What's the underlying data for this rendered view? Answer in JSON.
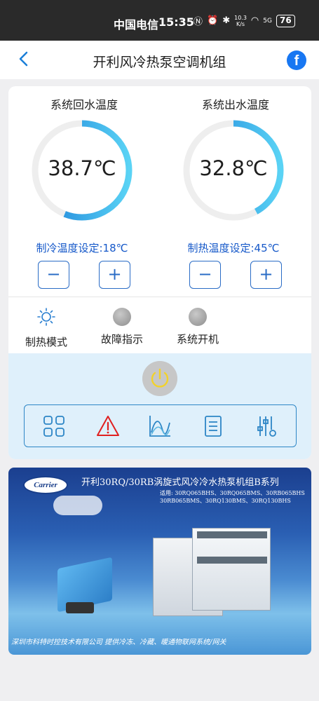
{
  "status_bar": {
    "carrier": "中国电信",
    "time": "15:35",
    "speed_top": "10.3",
    "speed_unit": "K/s",
    "network": "5G",
    "battery": "76"
  },
  "header": {
    "title": "开利风冷热泵空调机组",
    "facebook_label": "f"
  },
  "gauges": [
    {
      "label": "系统回水温度",
      "value": "38.7℃",
      "fill": 0.56,
      "setpoint": "制冷温度设定:18℃",
      "minus": "−",
      "plus": "+"
    },
    {
      "label": "系统出水温度",
      "value": "32.8℃",
      "fill": 0.42,
      "setpoint": "制热温度设定:45℃",
      "minus": "−",
      "plus": "+"
    }
  ],
  "indicators": [
    {
      "label": "制热模式",
      "icon": "sun-icon"
    },
    {
      "label": "故障指示",
      "icon": "grey-led-icon"
    },
    {
      "label": "系统开机",
      "icon": "grey-led-icon"
    }
  ],
  "toolbar": {
    "icons": [
      "grid-icon",
      "warning-icon",
      "chart-icon",
      "list-icon",
      "sliders-icon"
    ]
  },
  "banner": {
    "logo": "Carrier",
    "title": "开利30RQ/30RB涡旋式风冷冷水热泵机组B系列",
    "models_line1": "适用: 30RQ065BHS、30RQ065BMS、30RB065BHS",
    "models_line2": "30RB065BMS、30RQ130BMS、30RQ130BHS",
    "footer": "深圳市科特时控技术有限公司    提供冷冻、冷藏、暖通物联网系统/网关"
  },
  "colors": {
    "accent": "#2a6cc6",
    "gauge_start": "#1a7fd8",
    "gauge_end": "#5ad3f5",
    "track": "#eeeeee"
  }
}
